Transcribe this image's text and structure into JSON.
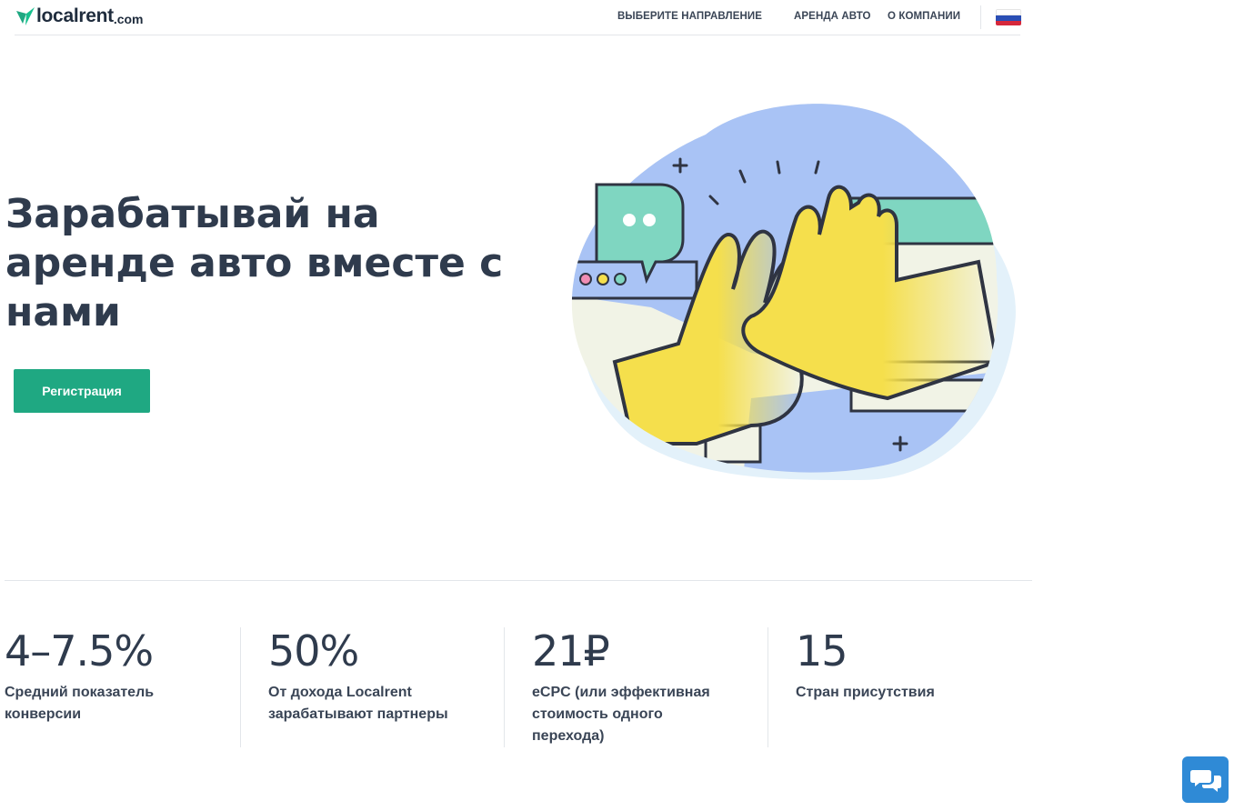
{
  "header": {
    "logo_text": "localrent",
    "logo_domain": ".com",
    "nav": [
      {
        "label": "ВЫБЕРИТЕ НАПРАВЛЕНИЕ"
      },
      {
        "label": "АРЕНДА АВТО"
      },
      {
        "label": "О КОМПАНИИ"
      }
    ],
    "language_flag": "russia-flag-icon"
  },
  "hero": {
    "title": "Зарабатывай на аренде авто вместе с нами",
    "register_label": "Регистрация",
    "illustration": "high-five-illustration"
  },
  "stats": [
    {
      "value": "4–7.5%",
      "label": "Средний показатель конверсии"
    },
    {
      "value": "50%",
      "label": "От дохода Localrent зарабатывают партнеры"
    },
    {
      "value": "21₽",
      "label": "eCPC (или эффективная стоимость одного перехода)"
    },
    {
      "value": "15",
      "label": "Стран присутствия"
    }
  ],
  "chat_widget": "chat-bubbles-icon",
  "colors": {
    "accent": "#1fa882",
    "chat": "#2f8ad6",
    "text": "#2f3b4d"
  }
}
